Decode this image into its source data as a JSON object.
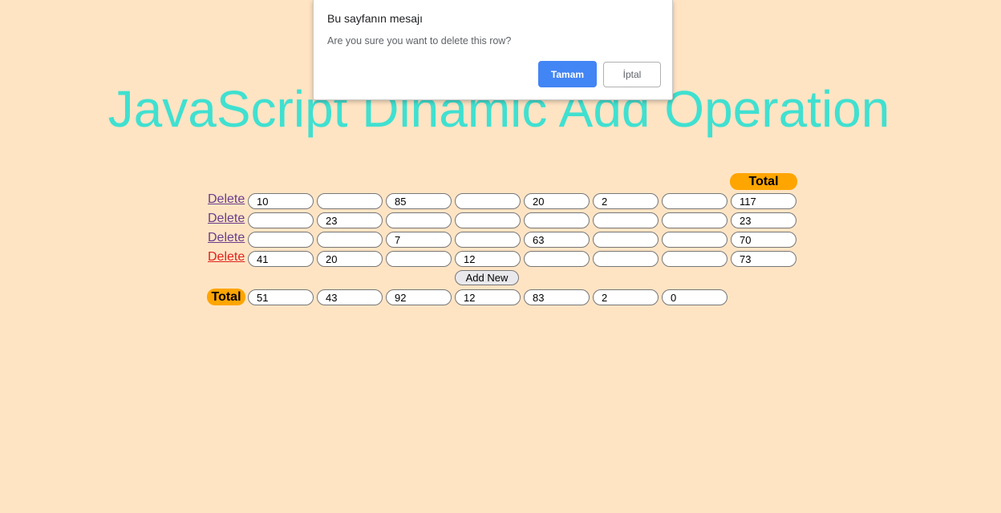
{
  "page": {
    "title": "JavaScript Dinamic Add Operation"
  },
  "table": {
    "total_header": "Total",
    "delete_label": "Delete",
    "rows": [
      [
        "10",
        "",
        "85",
        "",
        "20",
        "2",
        "",
        "117"
      ],
      [
        "",
        "23",
        "",
        "",
        "",
        "",
        "",
        "23"
      ],
      [
        "",
        "",
        "7",
        "",
        "63",
        "",
        "",
        "70"
      ],
      [
        "41",
        "20",
        "",
        "12",
        "",
        "",
        "",
        "73"
      ]
    ],
    "add_new_label": "Add New",
    "totals_label": "Total",
    "column_totals": [
      "51",
      "43",
      "92",
      "12",
      "83",
      "2",
      "0"
    ]
  },
  "dialog": {
    "title": "Bu sayfanın mesajı",
    "message": "Are you sure you want to delete this row?",
    "ok_label": "Tamam",
    "cancel_label": "İptal"
  },
  "colors": {
    "background": "#ffe4c4",
    "title": "#40e0d0",
    "total_pill": "#ffa500",
    "ok_button": "#4285f4"
  }
}
